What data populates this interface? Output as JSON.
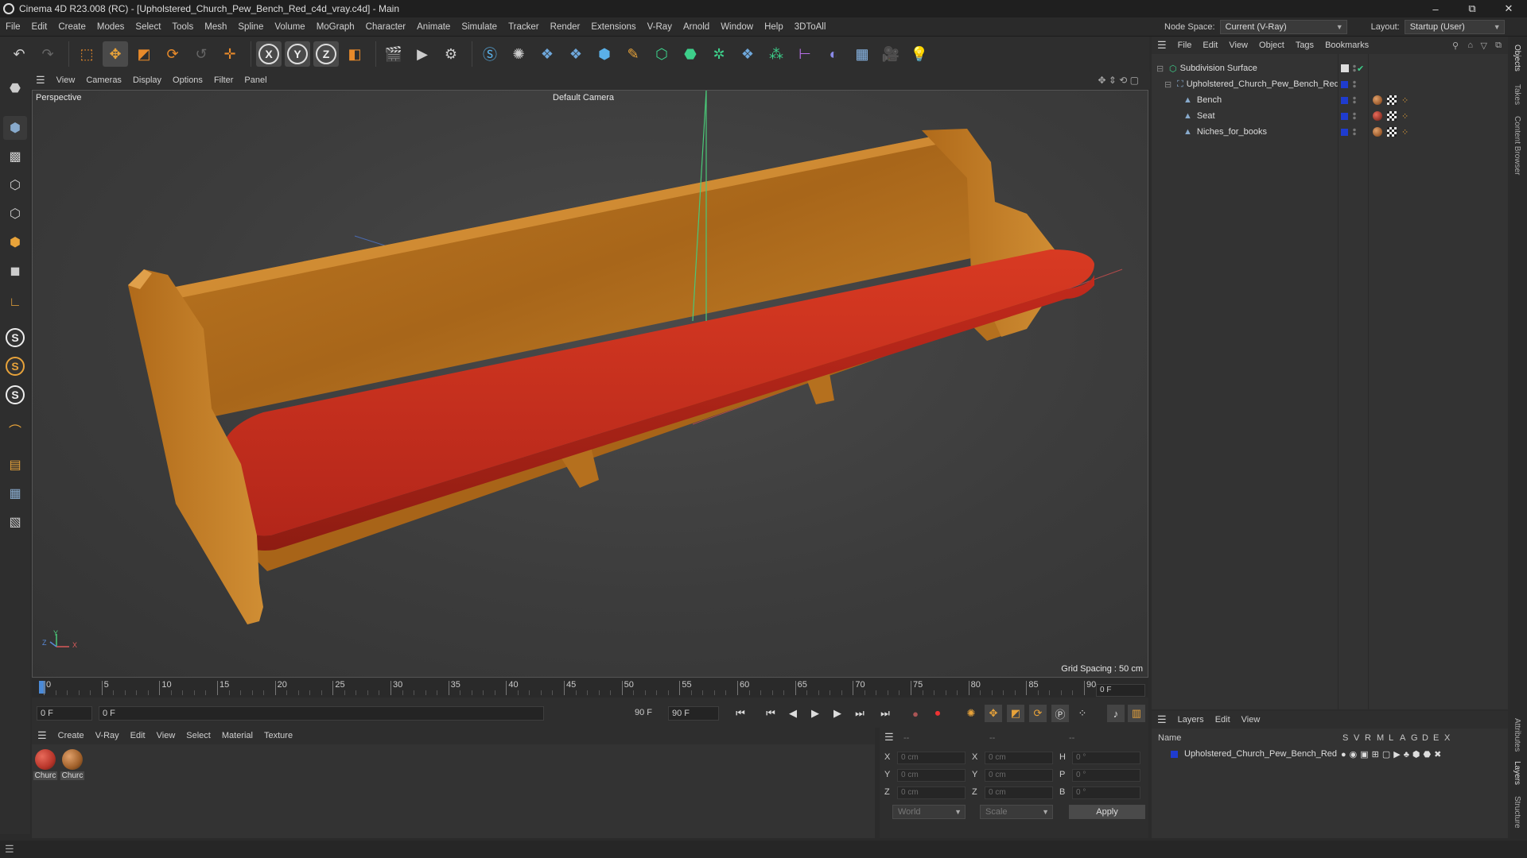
{
  "window": {
    "title": "Cinema 4D R23.008 (RC) - [Upholstered_Church_Pew_Bench_Red_c4d_vray.c4d] - Main",
    "controls": [
      "–",
      "⧉",
      "✕"
    ]
  },
  "menu": [
    "File",
    "Edit",
    "Create",
    "Modes",
    "Select",
    "Tools",
    "Mesh",
    "Spline",
    "Volume",
    "MoGraph",
    "Character",
    "Animate",
    "Simulate",
    "Tracker",
    "Render",
    "Extensions",
    "V-Ray",
    "Arnold",
    "Window",
    "Help",
    "3DToAll"
  ],
  "nodespace": {
    "label": "Node Space:",
    "value": "Current (V-Ray)"
  },
  "layout": {
    "label": "Layout:",
    "value": "Startup (User)"
  },
  "viewport": {
    "menu": [
      "View",
      "Cameras",
      "Display",
      "Options",
      "Filter",
      "Panel"
    ],
    "name": "Perspective",
    "camera": "Default Camera",
    "grid_spacing": "Grid Spacing : 50 cm",
    "axis_labels": {
      "x": "X",
      "y": "Y",
      "z": "Z"
    }
  },
  "timeline": {
    "ticks": [
      "0",
      "5",
      "10",
      "15",
      "20",
      "25",
      "30",
      "35",
      "40",
      "45",
      "50",
      "55",
      "60",
      "65",
      "70",
      "75",
      "80",
      "85",
      "90"
    ],
    "end_field": "0 F",
    "current_frame": "0 F",
    "range_start": "0 F",
    "range_end": "90 F",
    "max_frame": "90 F"
  },
  "material_manager": {
    "menu": [
      "Create",
      "V-Ray",
      "Edit",
      "View",
      "Select",
      "Material",
      "Texture"
    ],
    "materials": [
      {
        "label": "Churc",
        "color": "#b8352a"
      },
      {
        "label": "Churc",
        "color": "#a0602a"
      }
    ]
  },
  "coordinates": {
    "header": [
      "--",
      "--",
      "--"
    ],
    "rows": [
      {
        "a": "X",
        "av": "0 cm",
        "b": "X",
        "bv": "0 cm",
        "c": "H",
        "cv": "0 °"
      },
      {
        "a": "Y",
        "av": "0 cm",
        "b": "Y",
        "bv": "0 cm",
        "c": "P",
        "cv": "0 °"
      },
      {
        "a": "Z",
        "av": "0 cm",
        "b": "Z",
        "bv": "0 cm",
        "c": "B",
        "cv": "0 °"
      }
    ],
    "world": "World",
    "scale": "Scale",
    "apply": "Apply"
  },
  "objects": {
    "menu": [
      "File",
      "Edit",
      "View",
      "Object",
      "Tags",
      "Bookmarks"
    ],
    "items": [
      {
        "name": "Subdivision Surface",
        "indent": 0
      },
      {
        "name": "Upholstered_Church_Pew_Bench_Red",
        "indent": 1
      },
      {
        "name": "Bench",
        "indent": 2
      },
      {
        "name": "Seat",
        "indent": 2
      },
      {
        "name": "Niches_for_books",
        "indent": 2
      }
    ]
  },
  "layers": {
    "menu": [
      "Layers",
      "Edit",
      "View"
    ],
    "columns": {
      "name": "Name",
      "flags": [
        "S",
        "V",
        "R",
        "M",
        "L",
        "A",
        "G",
        "D",
        "E",
        "X"
      ]
    },
    "items": [
      {
        "name": "Upholstered_Church_Pew_Bench_Red"
      }
    ]
  },
  "side_tabs": [
    "Objects",
    "Takes",
    "Content Browser",
    "Attributes",
    "Layers",
    "Structure"
  ],
  "colors": {
    "accent": "#1f3ccf",
    "seat": "#c42a1c",
    "wood": "#b5701e"
  }
}
